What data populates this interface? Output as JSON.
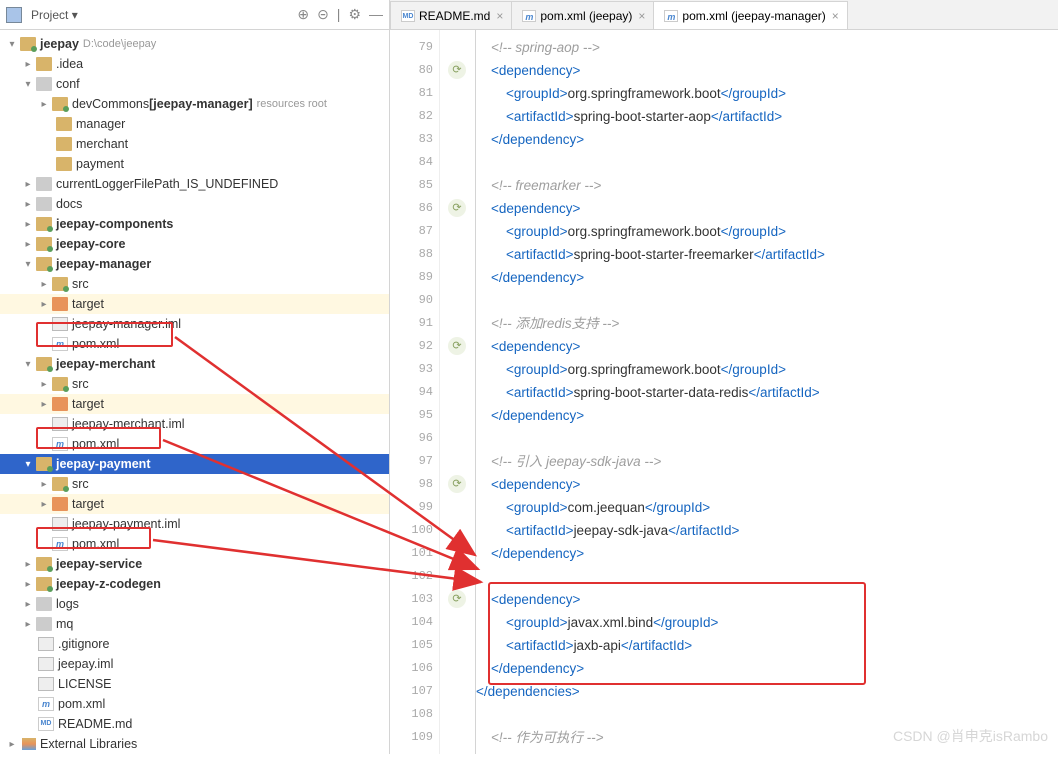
{
  "sidebar": {
    "title": "Project",
    "tools": [
      "⊕",
      "⊝",
      "÷",
      "✶",
      "⚙",
      "↔"
    ]
  },
  "tree": {
    "root": {
      "name": "jeepay",
      "path": "D:\\code\\jeepay"
    },
    "idea": ".idea",
    "conf": "conf",
    "devCommons": "devCommons",
    "devCommonsTag": "[jeepay-manager]",
    "devCommonsHint": "resources root",
    "manager": "manager",
    "merchant": "merchant",
    "payment": "payment",
    "currentLogger": "currentLoggerFilePath_IS_UNDEFINED",
    "docs": "docs",
    "components": "jeepay-components",
    "core": "jeepay-core",
    "mgr": "jeepay-manager",
    "src": "src",
    "target": "target",
    "imlMgr": "jeepay-manager.iml",
    "pom": "pom.xml",
    "mch": "jeepay-merchant",
    "imlMch": "jeepay-merchant.iml",
    "paymod": "jeepay-payment",
    "imlPay": "jeepay-payment.iml",
    "service": "jeepay-service",
    "codegen": "jeepay-z-codegen",
    "logs": "logs",
    "mq": "mq",
    "gitignore": ".gitignore",
    "jeepayiml": "jeepay.iml",
    "license": "LICENSE",
    "readme": "README.md",
    "extLibs": "External Libraries"
  },
  "tabs": [
    {
      "label": "README.md",
      "icon": "md"
    },
    {
      "label": "pom.xml (jeepay)",
      "icon": "m"
    },
    {
      "label": "pom.xml (jeepay-manager)",
      "icon": "m",
      "active": true
    }
  ],
  "lines": [
    79,
    80,
    81,
    82,
    83,
    84,
    85,
    86,
    87,
    88,
    89,
    90,
    91,
    92,
    93,
    94,
    95,
    96,
    97,
    98,
    99,
    100,
    101,
    102,
    103,
    104,
    105,
    106,
    107,
    108,
    109
  ],
  "folds": [
    80,
    86,
    92,
    98,
    103
  ],
  "code": [
    {
      "t": "cmt",
      "c": "    <!-- spring-aop -->"
    },
    {
      "t": "dep-open"
    },
    {
      "t": "grp",
      "v": "org.springframework.boot"
    },
    {
      "t": "art",
      "v": "spring-boot-starter-aop"
    },
    {
      "t": "dep-close"
    },
    {
      "t": "blank"
    },
    {
      "t": "cmt",
      "c": "    <!-- freemarker -->"
    },
    {
      "t": "dep-open"
    },
    {
      "t": "grp",
      "v": "org.springframework.boot"
    },
    {
      "t": "art",
      "v": "spring-boot-starter-freemarker"
    },
    {
      "t": "dep-close"
    },
    {
      "t": "blank"
    },
    {
      "t": "cmtcjk",
      "c": "    <!-- 添加redis支持 -->"
    },
    {
      "t": "dep-open"
    },
    {
      "t": "grp",
      "v": "org.springframework.boot"
    },
    {
      "t": "art",
      "v": "spring-boot-starter-data-redis"
    },
    {
      "t": "dep-close"
    },
    {
      "t": "blank"
    },
    {
      "t": "cmtcjk",
      "c": "    <!-- 引入 jeepay-sdk-java -->"
    },
    {
      "t": "dep-open"
    },
    {
      "t": "grp",
      "v": "com.jeequan"
    },
    {
      "t": "art",
      "v": "jeepay-sdk-java"
    },
    {
      "t": "dep-close"
    },
    {
      "t": "blank"
    },
    {
      "t": "dep-open"
    },
    {
      "t": "grp",
      "v": "javax.xml.bind"
    },
    {
      "t": "art",
      "v": "jaxb-api"
    },
    {
      "t": "dep-close"
    },
    {
      "t": "deps-close"
    },
    {
      "t": "blank"
    },
    {
      "t": "cmtcjk",
      "c": "    <!-- 作为可执行 -->"
    }
  ],
  "watermark": "CSDN @肖申克isRambo"
}
